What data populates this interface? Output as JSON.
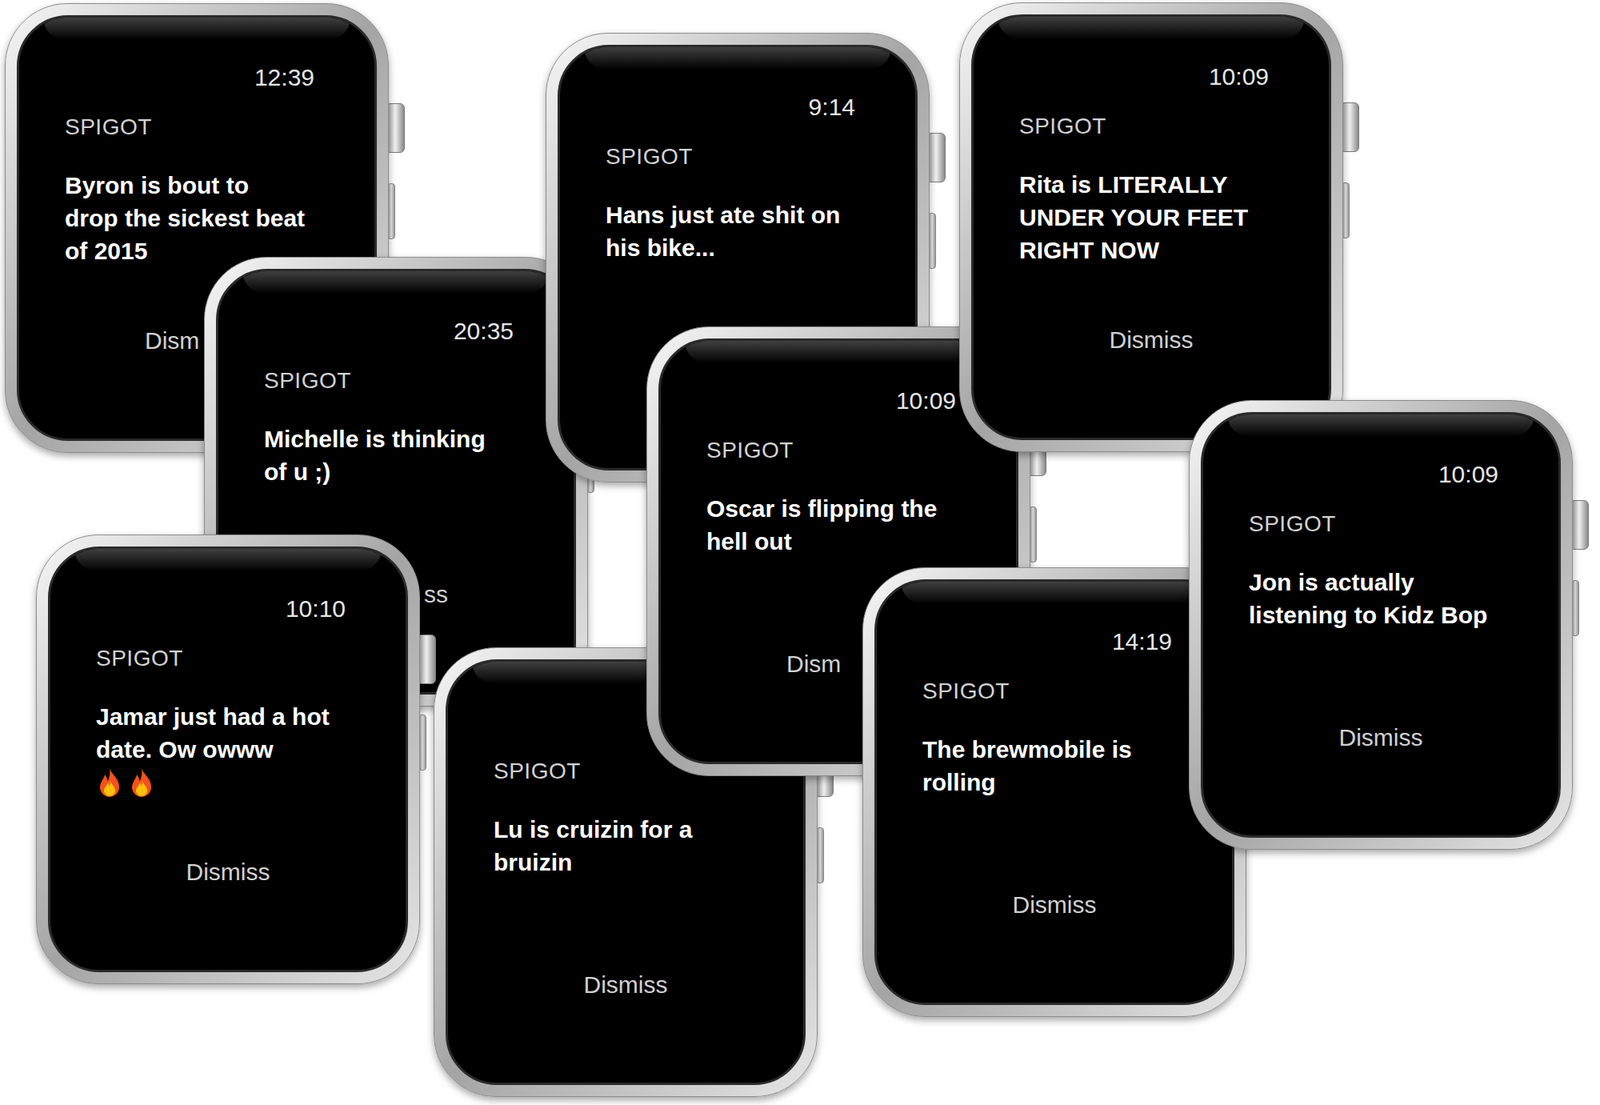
{
  "watches": [
    {
      "time": "12:39",
      "app": "SPIGOT",
      "message": "Byron is bout to drop the sickest beat of 2015",
      "reactions": [],
      "dismiss": {
        "label": "Dism",
        "kind": "cut-end"
      }
    },
    {
      "time": "20:35",
      "app": "SPIGOT",
      "message": "Michelle is thinking of u ;)",
      "reactions": [],
      "dismiss": {
        "label": "ss",
        "kind": "cut-start"
      }
    },
    {
      "time": "9:14",
      "app": "SPIGOT",
      "message": "Hans just ate shit on his bike...",
      "reactions": [],
      "dismiss": null
    },
    {
      "time": "10:10",
      "app": "SPIGOT",
      "message": "Jamar just had a hot date. Ow owww",
      "reactions": [
        {
          "kind": "fire"
        },
        {
          "kind": "fire"
        }
      ],
      "dismiss": {
        "label": "Dismiss",
        "kind": "full"
      }
    },
    {
      "time": null,
      "app": "SPIGOT",
      "message": "Lu is cruizin for a bruizin",
      "reactions": [],
      "dismiss": {
        "label": "Dismiss",
        "kind": "full"
      }
    },
    {
      "time": "10:09",
      "app": "SPIGOT",
      "message": "Oscar is flipping the hell out",
      "reactions": [],
      "dismiss": {
        "label": "Dism",
        "kind": "cut-end"
      }
    },
    {
      "time": "10:09",
      "app": "SPIGOT",
      "message": "Rita is LITERALLY UNDER YOUR FEET RIGHT NOW",
      "reactions": [],
      "dismiss": {
        "label": "Dismiss",
        "kind": "full"
      }
    },
    {
      "time": "14:19",
      "app": "SPIGOT",
      "message": "The brewmobile is rolling",
      "reactions": [],
      "dismiss": {
        "label": "Dismiss",
        "kind": "full"
      }
    },
    {
      "time": "10:09",
      "app": "SPIGOT",
      "message": "Jon is actually listening to Kidz Bop",
      "reactions": [],
      "dismiss": {
        "label": "Dismiss",
        "kind": "full"
      }
    }
  ]
}
